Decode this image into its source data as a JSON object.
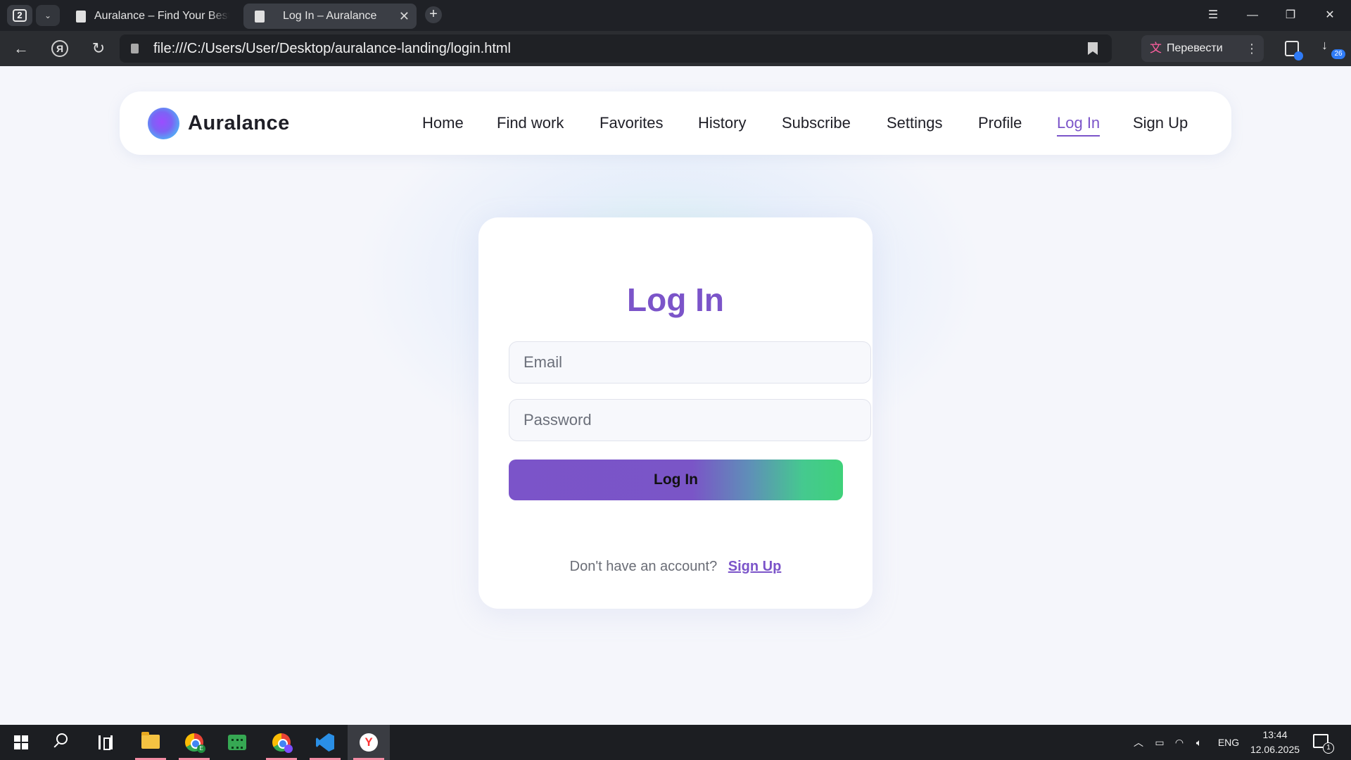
{
  "browser": {
    "tab_count": "2",
    "tabs": [
      {
        "title": "Auralance – Find Your Best",
        "active": false
      },
      {
        "title": "Log In – Auralance",
        "active": true
      }
    ],
    "url": "file:///C:/Users/User/Desktop/auralance-landing/login.html",
    "translate_label": "Перевести",
    "downloads_count": "26"
  },
  "site": {
    "brand": "Auralance",
    "nav": [
      {
        "label": "Home"
      },
      {
        "label": "Find work"
      },
      {
        "label": "Favorites"
      },
      {
        "label": "History"
      },
      {
        "label": "Subscribe"
      },
      {
        "label": "Settings"
      },
      {
        "label": "Profile"
      },
      {
        "label": "Log In",
        "active": true
      },
      {
        "label": "Sign Up"
      }
    ]
  },
  "login": {
    "title": "Log In",
    "email_placeholder": "Email",
    "password_placeholder": "Password",
    "submit_label": "Log In",
    "signup_prompt": "Don't have an account?",
    "signup_link": "Sign Up"
  },
  "taskbar": {
    "language": "ENG",
    "time": "13:44",
    "date": "12.06.2025",
    "notifications_count": "1"
  },
  "colors": {
    "accent": "#7b54c9",
    "gradient_end": "#3fd17a",
    "tab_underline": "#f28ba3"
  }
}
